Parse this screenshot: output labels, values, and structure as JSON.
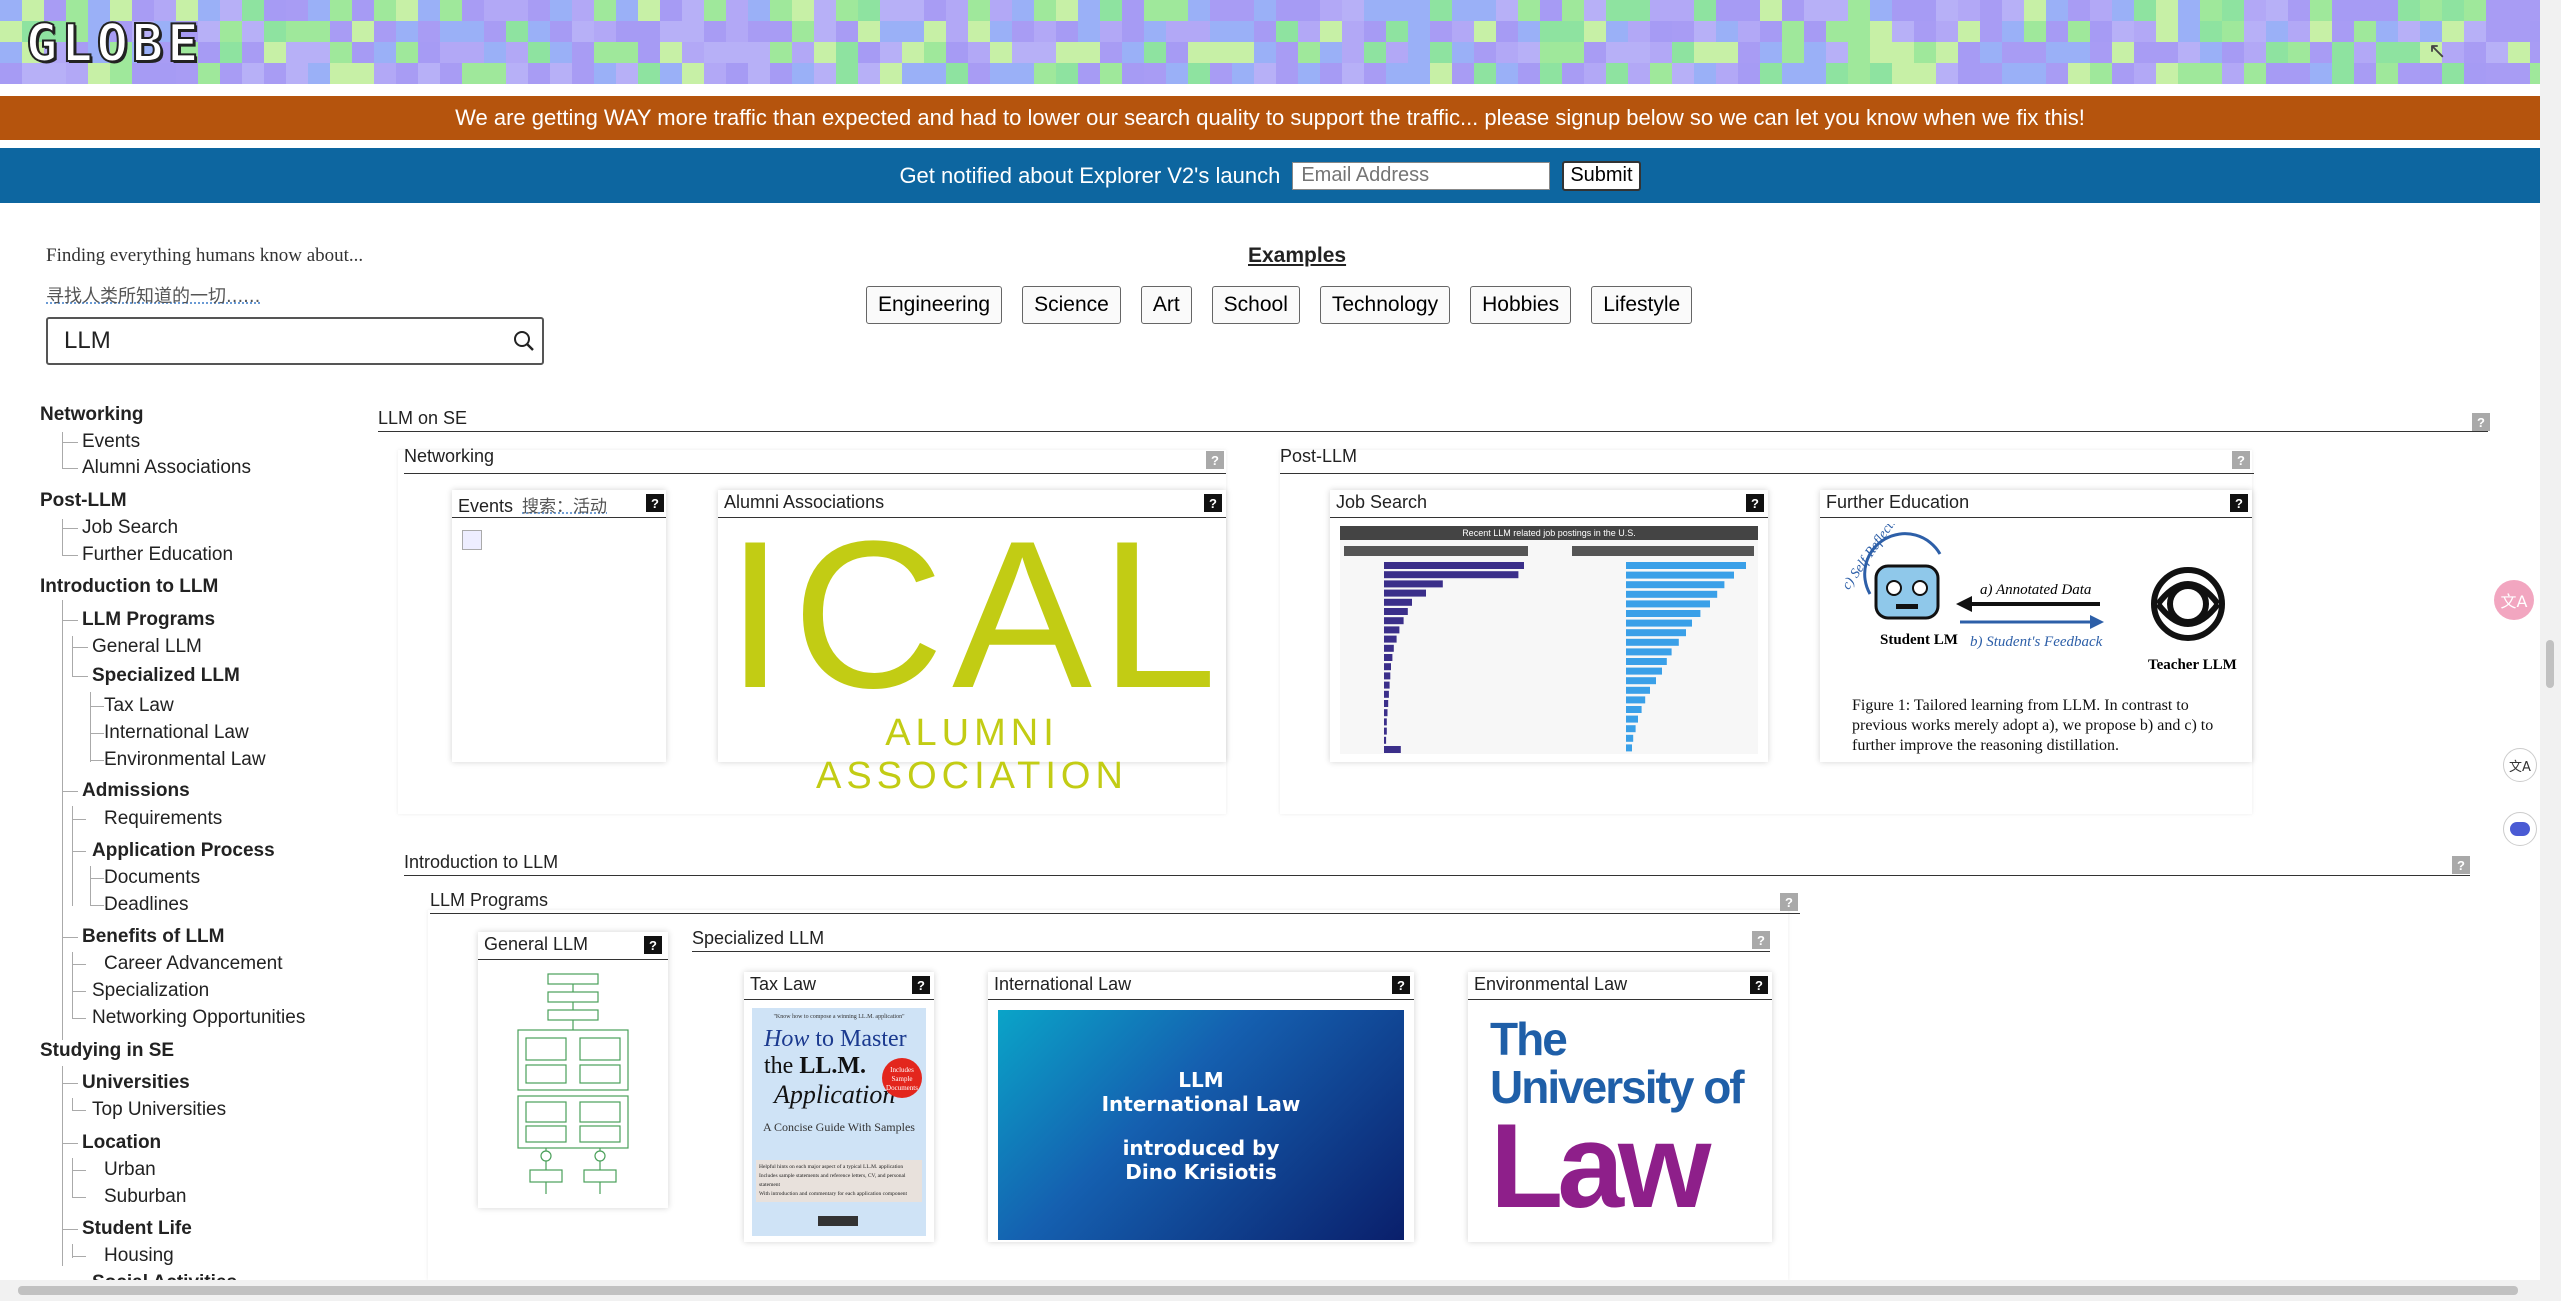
{
  "header": {
    "logo_text": "GLOBE",
    "mosaic_colors": [
      "#a89cf4",
      "#9fe89b",
      "#b7b0f7",
      "#9ab0f7",
      "#c7f0a6",
      "#a69bf4",
      "#8ee3a0",
      "#b2a8f6"
    ]
  },
  "traffic_banner": {
    "text": "We are getting WAY more traffic than expected and had to lower our search quality to support the traffic... please signup below so we can let you know when we fix this!",
    "color": "#b5540d"
  },
  "notify_banner": {
    "label": "Get notified about Explorer V2's launch",
    "email_placeholder": "Email Address",
    "submit_label": "Submit",
    "color": "#0d66a0"
  },
  "search": {
    "tagline": "Finding everything humans know about...",
    "tagline_cn": "寻找人类所知道的一切......",
    "query": "LLM",
    "icon": "search-icon"
  },
  "examples": {
    "title": "Examples",
    "items": [
      "Engineering",
      "Science",
      "Art",
      "School",
      "Technology",
      "Hobbies",
      "Lifestyle"
    ]
  },
  "sidebar": {
    "items": [
      {
        "label": "Networking"
      },
      {
        "label": "Events"
      },
      {
        "label": "Alumni Associations"
      },
      {
        "label": "Post-LLM"
      },
      {
        "label": "Job Search"
      },
      {
        "label": "Further Education"
      },
      {
        "label": "Introduction to LLM"
      },
      {
        "label": "LLM Programs"
      },
      {
        "label": "General LLM"
      },
      {
        "label": "Specialized LLM"
      },
      {
        "label": "Tax Law"
      },
      {
        "label": "International Law"
      },
      {
        "label": "Environmental Law"
      },
      {
        "label": "Admissions"
      },
      {
        "label": "Requirements"
      },
      {
        "label": "Application Process"
      },
      {
        "label": "Documents"
      },
      {
        "label": "Deadlines"
      },
      {
        "label": "Benefits of LLM"
      },
      {
        "label": "Career Advancement"
      },
      {
        "label": "Specialization"
      },
      {
        "label": "Networking Opportunities"
      },
      {
        "label": "Studying in SE"
      },
      {
        "label": "Universities"
      },
      {
        "label": "Top Universities"
      },
      {
        "label": "Location"
      },
      {
        "label": "Urban"
      },
      {
        "label": "Suburban"
      },
      {
        "label": "Student Life"
      },
      {
        "label": "Housing"
      },
      {
        "label": "Social Activities"
      }
    ]
  },
  "main": {
    "root_title": "LLM on SE",
    "qmark": "?",
    "networking": {
      "title": "Networking",
      "events_title": "Events",
      "events_title_cn": "搜索：活动",
      "alumni_title": "Alumni Associations",
      "alumni_logo_big": "ICAL",
      "alumni_logo_sub": "ALUMNI ASSOCIATION"
    },
    "post_llm": {
      "title": "Post-LLM",
      "job_title": "Job Search",
      "job_chart_title": "Recent LLM related job postings in the U.S.",
      "further_title": "Further Education",
      "further_student": "Student LM",
      "further_teacher": "Teacher LLM",
      "further_annotated": "a) Annotated Data",
      "further_feedback": "b) Student's Feedback",
      "further_reflection": "c) Self-Reflection",
      "further_caption": "Figure 1: Tailored learning from LLM. In contrast to previous works merely adopt a), we propose b) and c) to further improve the reasoning distillation."
    },
    "intro": {
      "title": "Introduction to LLM",
      "programs_title": "LLM Programs",
      "general_title": "General LLM",
      "specialized_title": "Specialized LLM",
      "tax_title": "Tax Law",
      "tax_book_kicker": "\"Know how to compose a winning LL.M. application\"",
      "tax_book_how": "How",
      "tax_book_to_master": " to Master",
      "tax_book_the": "the ",
      "tax_book_llm": "LL.M.",
      "tax_book_application": "Application",
      "tax_book_badge": "Includes Sample Documents",
      "tax_book_subtitle": "A Concise Guide With Samples",
      "tax_book_bullets": [
        "Helpful hints on each major aspect of a typical LL.M. application",
        "Includes sample statements and reference letters, CV, and personal statement",
        "With introduction and commentary for each application component"
      ],
      "intl_title": "International Law",
      "intl_line1": "LLM",
      "intl_line2": "International Law",
      "intl_line3": "introduced by",
      "intl_line4": "Dino Krisiotis",
      "env_title": "Environmental Law",
      "env_logo_line1": "The",
      "env_logo_line2": "University of",
      "env_logo_line3": "Law"
    }
  },
  "colors": {
    "alumni_yellow": "#c2cc14",
    "bar_navy": "#3b2f8a",
    "bar_blue": "#3aa0e8",
    "law_blue": "#1f5fa8",
    "law_purple": "#8e1f8a",
    "intl_grad_start": "#0aa4c8",
    "intl_grad_end": "#0a1f6b"
  }
}
